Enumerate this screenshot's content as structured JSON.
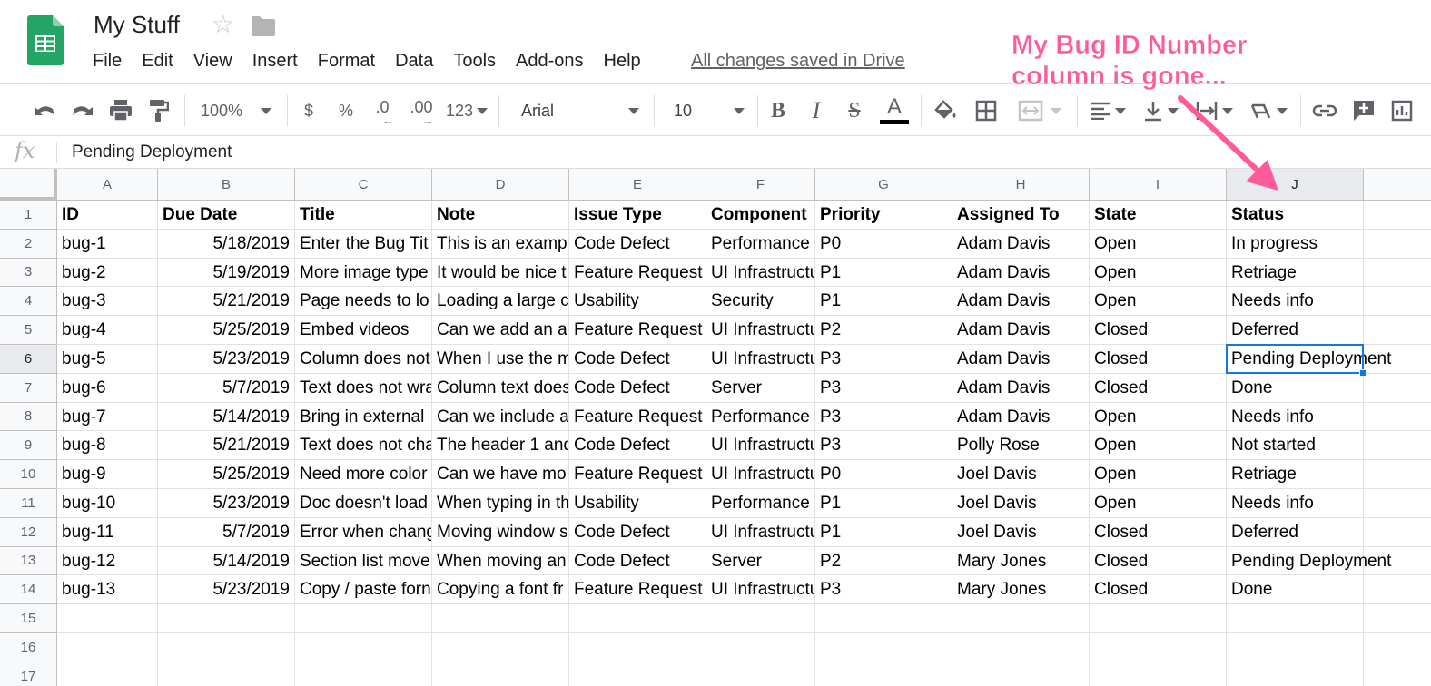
{
  "app": {
    "title": "My Stuff",
    "save_status": "All changes saved in Drive",
    "menu": [
      "File",
      "Edit",
      "View",
      "Insert",
      "Format",
      "Data",
      "Tools",
      "Add-ons",
      "Help"
    ]
  },
  "toolbar": {
    "zoom": "100%",
    "currency": "$",
    "percent": "%",
    "decrease_decimal": ".0",
    "increase_decimal": ".00",
    "number_format": "123",
    "font": "Arial",
    "font_size": "10",
    "bold": "B",
    "italic": "I",
    "strikethrough": "S",
    "text_color": "A"
  },
  "formula_bar": {
    "icon": "fx",
    "value": "Pending Deployment"
  },
  "annotation": {
    "line1": "My Bug ID Number",
    "line2": "column is gone...",
    "color": "#ff5b9a"
  },
  "sheet": {
    "columns": [
      "A",
      "B",
      "C",
      "D",
      "E",
      "F",
      "G",
      "H",
      "I",
      "J"
    ],
    "active_column": "J",
    "active_row": 6,
    "row_numbers": [
      1,
      2,
      3,
      4,
      5,
      6,
      7,
      8,
      9,
      10,
      11,
      12,
      13,
      14,
      15,
      16,
      17
    ],
    "header_row": [
      "ID",
      "Due Date",
      "Title",
      "Note",
      "Issue Type",
      "Component",
      "Priority",
      "Assigned To",
      "State",
      "Status"
    ],
    "rows": [
      [
        "bug-1",
        "5/18/2019",
        "Enter the Bug Tit",
        "This is an examp",
        "Code Defect",
        "Performance",
        "P0",
        "Adam Davis",
        "Open",
        "In progress"
      ],
      [
        "bug-2",
        "5/19/2019",
        "More image type",
        "It would be nice t",
        "Feature Request",
        "UI Infrastructu",
        "P1",
        "Adam Davis",
        "Open",
        "Retriage"
      ],
      [
        "bug-3",
        "5/21/2019",
        "Page needs to lo",
        "Loading a large c",
        "Usability",
        "Security",
        "P1",
        "Adam Davis",
        "Open",
        "Needs info"
      ],
      [
        "bug-4",
        "5/25/2019",
        "Embed videos",
        "Can we add an a",
        "Feature Request",
        "UI Infrastructu",
        "P2",
        "Adam Davis",
        "Closed",
        "Deferred"
      ],
      [
        "bug-5",
        "5/23/2019",
        "Column does not",
        "When I use the m",
        "Code Defect",
        "UI Infrastructu",
        "P3",
        "Adam Davis",
        "Closed",
        "Pending Deployment"
      ],
      [
        "bug-6",
        "5/7/2019",
        "Text does not wra",
        "Column text does",
        "Code Defect",
        "Server",
        "P3",
        "Adam Davis",
        "Closed",
        "Done"
      ],
      [
        "bug-7",
        "5/14/2019",
        "Bring in external",
        "Can we include a",
        "Feature Request",
        "Performance",
        "P3",
        "Adam Davis",
        "Open",
        "Needs info"
      ],
      [
        "bug-8",
        "5/21/2019",
        "Text does not cha",
        "The header 1 and",
        "Code Defect",
        "UI Infrastructu",
        "P3",
        "Polly Rose",
        "Open",
        "Not started"
      ],
      [
        "bug-9",
        "5/25/2019",
        "Need more color",
        "Can we have mo",
        "Feature Request",
        "UI Infrastructu",
        "P0",
        "Joel Davis",
        "Open",
        "Retriage"
      ],
      [
        "bug-10",
        "5/23/2019",
        "Doc doesn't load",
        "When typing in th",
        "Usability",
        "Performance",
        "P1",
        "Joel Davis",
        "Open",
        "Needs info"
      ],
      [
        "bug-11",
        "5/7/2019",
        "Error when chang",
        "Moving window s",
        "Code Defect",
        "UI Infrastructu",
        "P1",
        "Joel Davis",
        "Closed",
        "Deferred"
      ],
      [
        "bug-12",
        "5/14/2019",
        "Section list move",
        "When moving an",
        "Code Defect",
        "Server",
        "P2",
        "Mary Jones",
        "Closed",
        "Pending Deployment"
      ],
      [
        "bug-13",
        "5/23/2019",
        "Copy / paste forn",
        "Copying a font fr",
        "Feature Request",
        "UI Infrastructu",
        "P3",
        "Mary Jones",
        "Closed",
        "Done"
      ],
      [
        "",
        "",
        "",
        "",
        "",
        "",
        "",
        "",
        "",
        ""
      ],
      [
        "",
        "",
        "",
        "",
        "",
        "",
        "",
        "",
        "",
        ""
      ],
      [
        "",
        "",
        "",
        "",
        "",
        "",
        "",
        "",
        "",
        ""
      ]
    ]
  }
}
